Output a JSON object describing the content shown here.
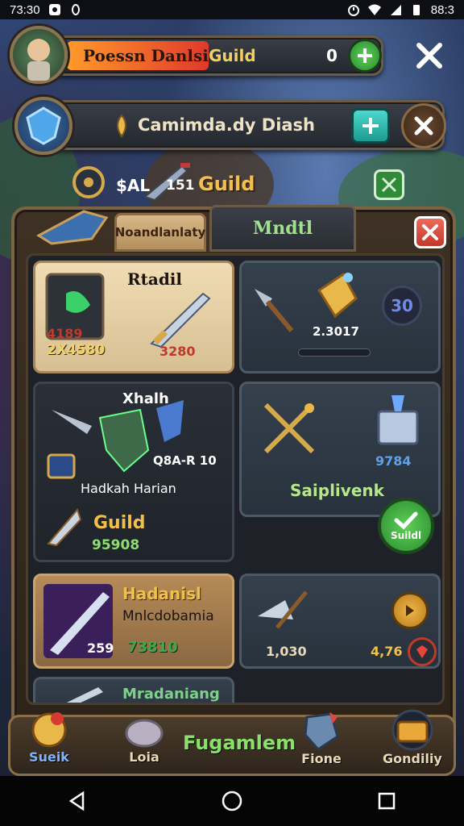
{
  "status_bar": {
    "time": "73:30",
    "battery": "88:3"
  },
  "profile_bar": {
    "name": "Poessn Danlsi",
    "guild": "Guild",
    "currency_value": "0"
  },
  "second_bar": {
    "title": "Camimda.dy Diash"
  },
  "guild_row": {
    "level_label": "$AL",
    "level_value": "151",
    "guild_label": "Guild"
  },
  "tabs": [
    {
      "label": "Noandlanlaty"
    },
    {
      "label": "Mndtl"
    }
  ],
  "cards": {
    "featured": {
      "title": "Rtadil",
      "value_top": "4189",
      "value_bottom": "2X4580",
      "price": "3280"
    },
    "slot_a": {
      "value": "2.3017",
      "badge": "30"
    },
    "xhalh": {
      "title": "Xhalh",
      "code": "Q8A-R 10",
      "subtitle": "Hadkah Harian",
      "guild": "Guild",
      "price": "95908"
    },
    "seplivenk": {
      "value": "9784",
      "title": "Saiplivenk",
      "button": "Suildl"
    },
    "hadanisl": {
      "title": "Hadanisl",
      "subtitle": "Mnlcdobamia",
      "qty": "259",
      "price": "73810"
    },
    "slot_b": {
      "price": "1,030",
      "value": "4,76"
    },
    "partial": {
      "title": "Mradaniang"
    }
  },
  "bottom_nav": {
    "items": [
      {
        "label": "Sueik"
      },
      {
        "label": "Loia"
      },
      {
        "label": "Fugamlem"
      },
      {
        "label": "Fione"
      },
      {
        "label": "Gondiliy"
      }
    ]
  },
  "colors": {
    "accent_green": "#3fb24a",
    "accent_red": "#d63b31",
    "gold": "#e9b84a",
    "panel_brown": "#3e3124"
  },
  "icons": {
    "close": "close-icon",
    "add": "plus-icon",
    "check": "check-icon"
  }
}
